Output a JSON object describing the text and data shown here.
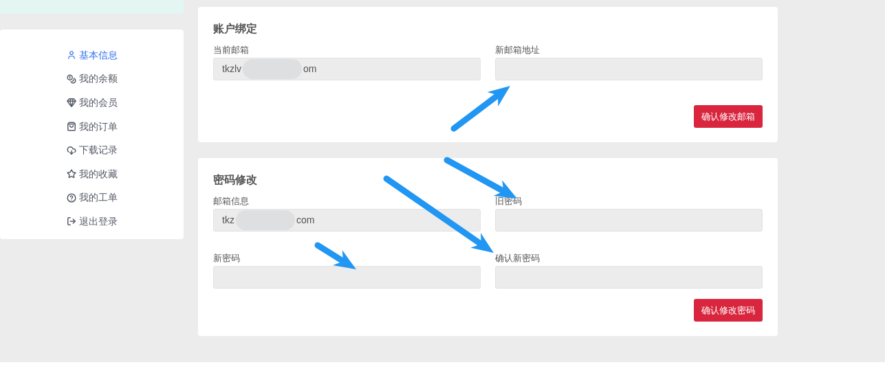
{
  "sidebar": {
    "items": [
      {
        "label": "基本信息",
        "selected": true
      },
      {
        "label": "我的余额",
        "selected": false
      },
      {
        "label": "我的会员",
        "selected": false
      },
      {
        "label": "我的订单",
        "selected": false
      },
      {
        "label": "下载记录",
        "selected": false
      },
      {
        "label": "我的收藏",
        "selected": false
      },
      {
        "label": "我的工单",
        "selected": false
      },
      {
        "label": "退出登录",
        "selected": false
      }
    ]
  },
  "sections": [
    {
      "title": "账户绑定",
      "fields": [
        {
          "label": "当前邮箱",
          "value_parts": [
            "tkzlv",
            "om"
          ]
        },
        {
          "label": "新邮箱地址"
        }
      ],
      "button": "确认修改邮箱"
    },
    {
      "title": "密码修改",
      "fields": [
        {
          "label": "邮箱信息",
          "value_parts": [
            "tkz",
            "com"
          ]
        },
        {
          "label": "旧密码"
        },
        {
          "label": "新密码"
        },
        {
          "label": "确认新密码"
        }
      ],
      "button": "确认修改密码"
    }
  ],
  "annotations": [
    {
      "kind": "arrow"
    },
    {
      "kind": "arrow"
    },
    {
      "kind": "arrow"
    },
    {
      "kind": "arrow"
    }
  ]
}
